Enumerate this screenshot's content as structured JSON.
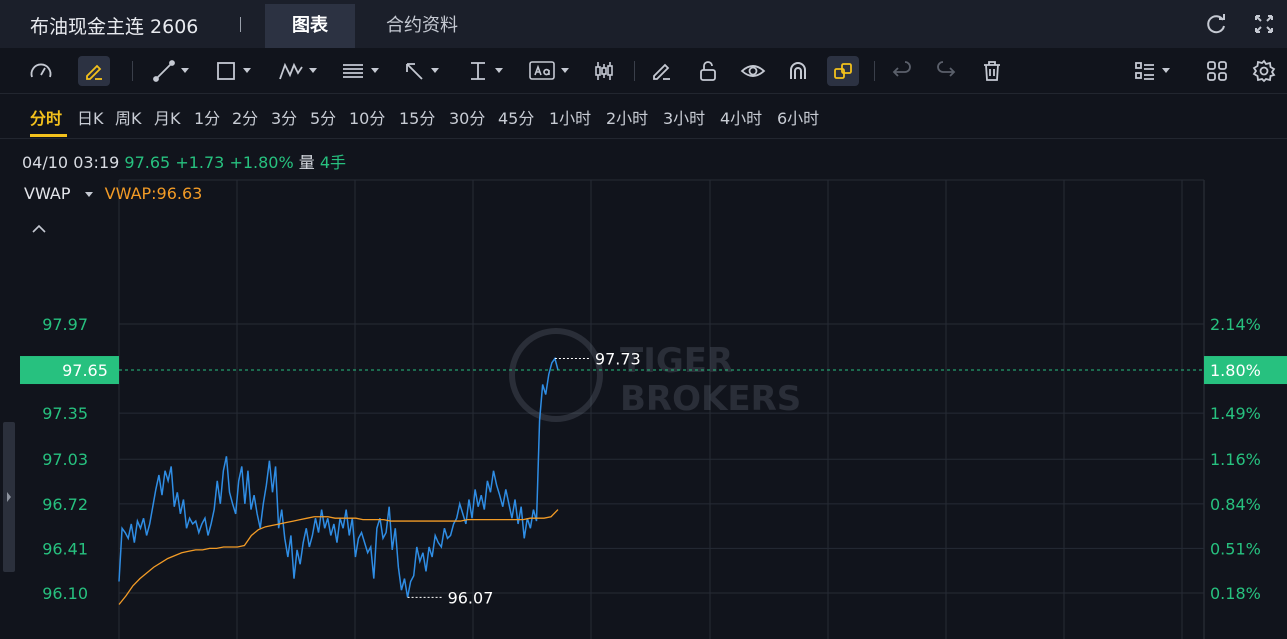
{
  "header": {
    "instrument": "布油现金主连 2606",
    "tabs": [
      "图表",
      "合约资料"
    ]
  },
  "toolbar": {
    "icons": [
      "speedometer-icon",
      "pen-edit-icon",
      "line-tool-icon",
      "rectangle-tool-icon",
      "pattern-tool-icon",
      "fibonacci-tool-icon",
      "arrow-tool-icon",
      "measure-tool-icon",
      "text-tool-icon",
      "candles-tool-icon",
      "pencil-icon",
      "unlock-icon",
      "eye-icon",
      "magnet-icon",
      "link-icon",
      "undo-icon",
      "redo-icon",
      "trash-icon",
      "list-settings-icon",
      "grid-icon",
      "gear-icon"
    ],
    "right_icons": [
      "refresh-icon",
      "expand-icon"
    ]
  },
  "periods": [
    "分时",
    "日K",
    "周K",
    "月K",
    "1分",
    "2分",
    "3分",
    "5分",
    "10分",
    "15分",
    "30分",
    "45分",
    "1小时",
    "2小时",
    "3小时",
    "4小时",
    "6小时"
  ],
  "active_period": "分时",
  "info": {
    "datetime": "04/10 03:19",
    "price": "97.65",
    "change": "+1.73",
    "change_pct": "+1.80%",
    "volume_label": "量",
    "volume": "4手"
  },
  "indicator": {
    "name": "VWAP",
    "value_text": "VWAP:96.63"
  },
  "watermark": [
    "TIGER",
    "BROKERS"
  ],
  "colors": {
    "up": "#27c17f",
    "price_line": "#2f8de4",
    "vwap_line": "#f29b26",
    "background": "#11141c",
    "active_period": "#f3c11c"
  },
  "chart_data": {
    "type": "line",
    "ylim": [
      96.0,
      98.2
    ],
    "y_ticks": [
      "97.97",
      "97.35",
      "97.03",
      "96.72",
      "96.41",
      "96.10"
    ],
    "right_ticks": [
      "2.14%",
      "1.49%",
      "1.16%",
      "0.84%",
      "0.51%",
      "0.18%"
    ],
    "current_price": "97.65",
    "current_pct": "1.80%",
    "high_label": "97.73",
    "low_label": "96.07",
    "high": 97.73,
    "low": 96.07,
    "price_series": [
      96.18,
      96.55,
      96.52,
      96.48,
      96.58,
      96.45,
      96.6,
      96.55,
      96.62,
      96.5,
      96.58,
      96.7,
      96.82,
      96.92,
      96.78,
      96.95,
      96.88,
      96.98,
      96.7,
      96.8,
      96.65,
      96.75,
      96.55,
      96.62,
      96.58,
      96.6,
      96.52,
      96.58,
      96.62,
      96.5,
      96.58,
      96.68,
      96.88,
      96.72,
      96.95,
      97.05,
      96.8,
      96.72,
      96.65,
      96.88,
      96.98,
      96.72,
      96.95,
      96.68,
      96.78,
      96.65,
      96.55,
      96.72,
      96.85,
      97.02,
      96.8,
      96.98,
      96.55,
      96.68,
      96.48,
      96.35,
      96.5,
      96.2,
      96.4,
      96.3,
      96.45,
      96.55,
      96.42,
      96.5,
      96.62,
      96.52,
      96.68,
      96.55,
      96.62,
      96.5,
      96.58,
      96.45,
      96.62,
      96.55,
      96.68,
      96.5,
      96.62,
      96.35,
      96.48,
      96.52,
      96.45,
      96.38,
      96.42,
      96.2,
      96.55,
      96.62,
      96.48,
      96.52,
      96.7,
      96.4,
      96.55,
      96.28,
      96.12,
      96.2,
      96.07,
      96.18,
      96.22,
      96.42,
      96.32,
      96.38,
      96.25,
      96.42,
      96.35,
      96.5,
      96.45,
      96.42,
      96.55,
      96.48,
      96.5,
      96.58,
      96.62,
      96.72,
      96.65,
      96.58,
      96.75,
      96.62,
      96.82,
      96.7,
      96.78,
      96.68,
      96.88,
      96.8,
      96.95,
      96.85,
      96.78,
      96.7,
      96.82,
      96.72,
      96.62,
      96.75,
      96.58,
      96.7,
      96.48,
      96.62,
      96.55,
      96.68,
      96.6,
      97.3,
      97.55,
      97.48,
      97.62,
      97.7,
      97.73,
      97.65
    ],
    "vwap_series": [
      96.02,
      96.08,
      96.15,
      96.2,
      96.24,
      96.28,
      96.31,
      96.34,
      96.36,
      96.38,
      96.39,
      96.4,
      96.4,
      96.41,
      96.41,
      96.42,
      96.42,
      96.42,
      96.43,
      96.5,
      96.54,
      96.56,
      96.57,
      96.58,
      96.59,
      96.6,
      96.61,
      96.62,
      96.63,
      96.63,
      96.63,
      96.62,
      96.62,
      96.62,
      96.62,
      96.61,
      96.61,
      96.61,
      96.61,
      96.6,
      96.6,
      96.6,
      96.6,
      96.6,
      96.6,
      96.6,
      96.6,
      96.6,
      96.6,
      96.6,
      96.61,
      96.61,
      96.61,
      96.61,
      96.61,
      96.61,
      96.61,
      96.61,
      96.61,
      96.62,
      96.62,
      96.62,
      96.63,
      96.68
    ]
  }
}
